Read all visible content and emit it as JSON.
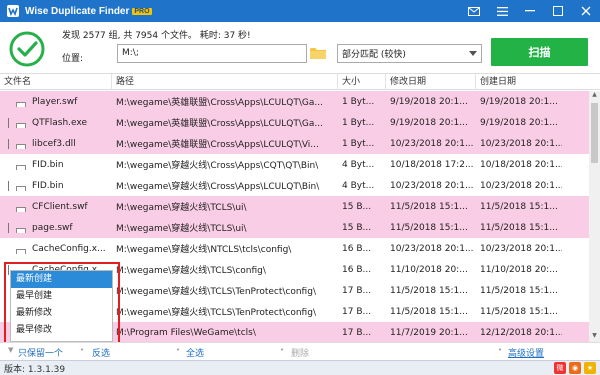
{
  "window": {
    "title": "Wise Duplicate Finder",
    "badge": "PRO",
    "controls": [
      "envelope-icon",
      "menu-icon",
      "minimize-icon",
      "maximize-icon",
      "close-icon"
    ]
  },
  "header": {
    "status": "发现 2577 组, 共 7954 个文件。 耗时: 37 秒!",
    "location_label": "位置:",
    "location_value": "M:\\;",
    "match_mode": "部分匹配 (较快)",
    "scan_button": "扫描"
  },
  "table": {
    "columns": [
      "文件名",
      "路径",
      "大小",
      "修改日期",
      "创建日期"
    ],
    "rows": [
      {
        "name": "Player.swf",
        "path": "M:\\wegame\\英雄联盟\\Cross\\Apps\\LCULQT\\Ga...",
        "size": "1 Byt...",
        "modified": "9/19/2018 20:1...",
        "created": "9/19/2018 20:1...",
        "color": "pink"
      },
      {
        "name": "QTFlash.exe",
        "path": "M:\\wegame\\英雄联盟\\Cross\\Apps\\LCULQT\\Ga...",
        "size": "1 Byt...",
        "modified": "9/19/2018 20:1...",
        "created": "9/19/2018 20:1...",
        "color": "pink"
      },
      {
        "name": "libcef3.dll",
        "path": "M:\\wegame\\英雄联盟\\Cross\\Apps\\LCULQT\\Vi...",
        "size": "1 Byt...",
        "modified": "10/23/2018 20:1...",
        "created": "10/23/2018 20:1...",
        "color": "pink"
      },
      {
        "name": "FID.bin",
        "path": "M:\\wegame\\穿越火线\\Cross\\Apps\\CQT\\QT\\Bin\\",
        "size": "4 Byt...",
        "modified": "10/18/2018 17:2...",
        "created": "10/18/2018 20:1...",
        "color": "white"
      },
      {
        "name": "FID.bin",
        "path": "M:\\wegame\\穿越火线\\Cross\\Apps\\LCULQT\\Bin\\",
        "size": "4 Byt...",
        "modified": "10/23/2018 20:1...",
        "created": "10/23/2018 20:1...",
        "color": "white"
      },
      {
        "name": "CFClient.swf",
        "path": "M:\\wegame\\穿越火线\\TCLS\\ui\\",
        "size": "15 B...",
        "modified": "11/5/2018 15:1...",
        "created": "11/5/2018 15:1...",
        "color": "pink"
      },
      {
        "name": "page.swf",
        "path": "M:\\wegame\\穿越火线\\TCLS\\ui\\",
        "size": "15 B...",
        "modified": "11/5/2018 15:1...",
        "created": "11/5/2018 15:1...",
        "color": "pink"
      },
      {
        "name": "CacheConfig.x...",
        "path": "M:\\wegame\\穿越火线\\NTCLS\\tcls\\config\\",
        "size": "16 B...",
        "modified": "10/23/2018 20:1...",
        "created": "10/23/2018 20:1...",
        "color": "white"
      },
      {
        "name": "CacheConfig.x...",
        "path": "M:\\wegame\\穿越火线\\TCLS\\config\\",
        "size": "16 B...",
        "modified": "11/10/2018 20:...",
        "created": "11/10/2018 20:...",
        "color": "white"
      },
      {
        "name": "",
        "path": "M:\\wegame\\穿越火线\\TCLS\\TenProtect\\config\\",
        "size": "17 B...",
        "modified": "11/5/2018 15:1...",
        "created": "11/5/2018 15:1...",
        "color": "white"
      },
      {
        "name": "",
        "path": "M:\\wegame\\穿越火线\\TCLS\\TenProtect\\config\\",
        "size": "17 B...",
        "modified": "11/5/2018 15:1...",
        "created": "11/5/2018 15:1...",
        "color": "white"
      },
      {
        "name": "",
        "path": "M:\\Program Files\\WeGame\\tcls\\",
        "size": "17 B...",
        "modified": "11/7/2019 20:1...",
        "created": "12/12/2018 20:1...",
        "color": "pink"
      }
    ]
  },
  "context_menu": {
    "items": [
      "最新创建",
      "最早创建",
      "最新修改",
      "最早修改"
    ],
    "active_index": 0
  },
  "toolbar": {
    "keep_one": "只保留一个",
    "invert": "反选",
    "select_all": "全选",
    "delete": "删除",
    "advanced": "高级设置"
  },
  "statusbar": {
    "version": "版本: 1.3.1.39"
  },
  "colors": {
    "titlebar": "#1f74c9",
    "scan_button": "#23b246",
    "pink_row": "#f9cde6",
    "menu_highlight": "#2c8bd9",
    "highlight_box": "#e02020"
  }
}
